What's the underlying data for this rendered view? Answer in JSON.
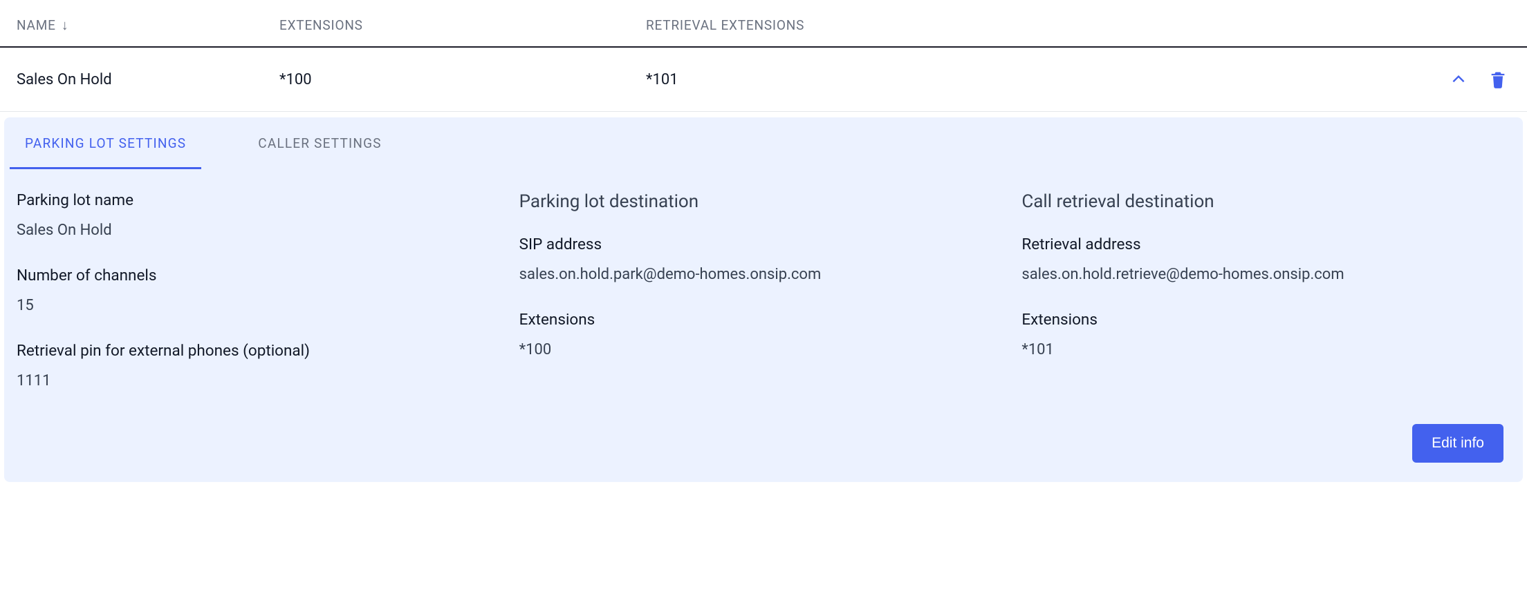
{
  "table": {
    "headers": {
      "name": "NAME",
      "extensions": "EXTENSIONS",
      "retrieval_extensions": "RETRIEVAL EXTENSIONS"
    },
    "row": {
      "name": "Sales On Hold",
      "extensions": "*100",
      "retrieval_extensions": "*101"
    }
  },
  "tabs": {
    "parking": "PARKING LOT SETTINGS",
    "caller": "CALLER SETTINGS"
  },
  "details": {
    "col1": {
      "name_label": "Parking lot name",
      "name_value": "Sales On Hold",
      "channels_label": "Number of channels",
      "channels_value": "15",
      "pin_label": "Retrieval pin for external phones (optional)",
      "pin_value": "1111"
    },
    "col2": {
      "heading": "Parking lot destination",
      "sip_label": "SIP address",
      "sip_value": "sales.on.hold.park@demo-homes.onsip.com",
      "ext_label": "Extensions",
      "ext_value": "*100"
    },
    "col3": {
      "heading": "Call retrieval destination",
      "addr_label": "Retrieval address",
      "addr_value": "sales.on.hold.retrieve@demo-homes.onsip.com",
      "ext_label": "Extensions",
      "ext_value": "*101"
    }
  },
  "buttons": {
    "edit": "Edit info"
  }
}
